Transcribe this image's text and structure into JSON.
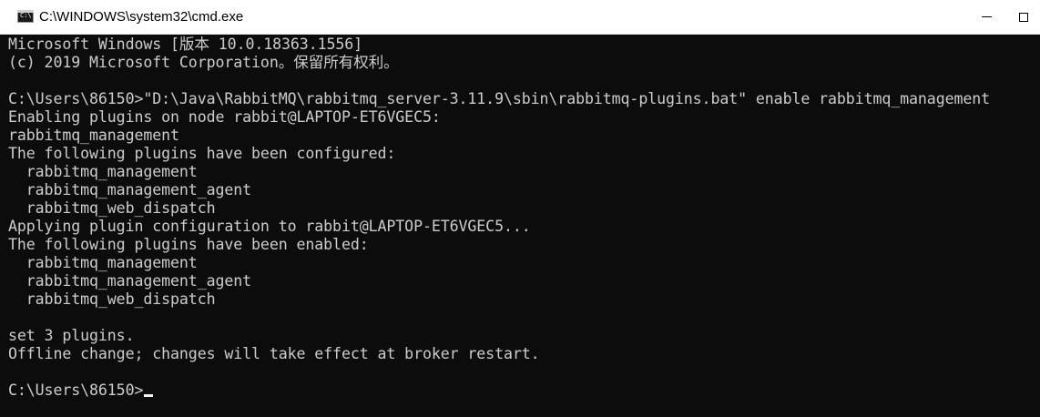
{
  "window": {
    "title": "C:\\WINDOWS\\system32\\cmd.exe",
    "icon": "cmd-console-icon",
    "icon_glyph": "C:\\"
  },
  "controls": {
    "minimize_icon": "minimize-icon",
    "maximize_icon": "maximize-icon"
  },
  "console": {
    "background": "#0c0c0c",
    "foreground": "#cccccc",
    "lines": [
      "Microsoft Windows [版本 10.0.18363.1556]",
      "(c) 2019 Microsoft Corporation。保留所有权利。",
      "",
      "C:\\Users\\86150>\"D:\\Java\\RabbitMQ\\rabbitmq_server-3.11.9\\sbin\\rabbitmq-plugins.bat\" enable rabbitmq_management",
      "Enabling plugins on node rabbit@LAPTOP-ET6VGEC5:",
      "rabbitmq_management",
      "The following plugins have been configured:",
      "  rabbitmq_management",
      "  rabbitmq_management_agent",
      "  rabbitmq_web_dispatch",
      "Applying plugin configuration to rabbit@LAPTOP-ET6VGEC5...",
      "The following plugins have been enabled:",
      "  rabbitmq_management",
      "  rabbitmq_management_agent",
      "  rabbitmq_web_dispatch",
      "",
      "set 3 plugins.",
      "Offline change; changes will take effect at broker restart.",
      "",
      "C:\\Users\\86150>"
    ]
  }
}
